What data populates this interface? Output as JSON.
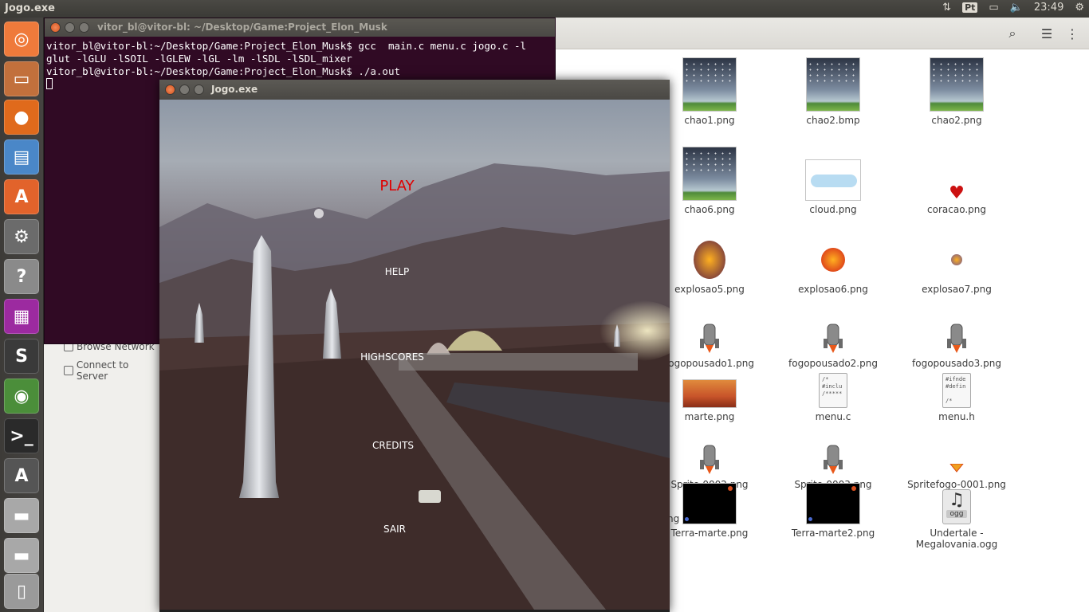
{
  "top_panel": {
    "app_title": "Jogo.exe",
    "keyboard_layout": "Pt",
    "clock": "23:49",
    "indicator_icons": [
      "network-arrows-icon",
      "battery-icon",
      "volume-icon",
      "gear-icon"
    ]
  },
  "launcher": {
    "items": [
      {
        "name": "dash-home-icon",
        "glyph": "◎",
        "color": "#ef7a3b"
      },
      {
        "name": "files-icon",
        "glyph": "▭",
        "color": "#c2703c"
      },
      {
        "name": "firefox-icon",
        "glyph": "●",
        "color": "#e06a1c"
      },
      {
        "name": "writer-icon",
        "glyph": "▤",
        "color": "#4a87c8"
      },
      {
        "name": "software-center-icon",
        "glyph": "A",
        "color": "#e2632b"
      },
      {
        "name": "system-settings-icon",
        "glyph": "⚙",
        "color": "#6b6b6b"
      },
      {
        "name": "help-icon",
        "glyph": "?",
        "color": "#8a8a8a"
      },
      {
        "name": "app-window-icon",
        "glyph": "▦",
        "color": "#9c2aa0"
      },
      {
        "name": "sublime-text-icon",
        "glyph": "S",
        "color": "#3a3a3a"
      },
      {
        "name": "chrome-icon",
        "glyph": "◉",
        "color": "#4b8e3a"
      },
      {
        "name": "terminal-icon",
        "glyph": ">_",
        "color": "#2a2a2a"
      },
      {
        "name": "software-updater-icon",
        "glyph": "A",
        "color": "#555555"
      },
      {
        "name": "drive-icon",
        "glyph": "▬",
        "color": "#a8a8a8"
      },
      {
        "name": "drive-2-icon",
        "glyph": "▬",
        "color": "#a8a8a8"
      },
      {
        "name": "trash-icon",
        "glyph": "▯",
        "color": "#9a9a9a"
      }
    ]
  },
  "file_manager": {
    "sidebar": {
      "items": [
        {
          "label": "Browse Network"
        },
        {
          "label": "Connect to Server"
        }
      ]
    },
    "files": [
      {
        "label": "chao1.png",
        "kind": "sky"
      },
      {
        "label": "chao2.bmp",
        "kind": "sky"
      },
      {
        "label": "chao2.png",
        "kind": "sky"
      },
      {
        "label": "chao6.png",
        "kind": "sky"
      },
      {
        "label": "cloud.png",
        "kind": "cloud"
      },
      {
        "label": "coracao.png",
        "kind": "heart"
      },
      {
        "label": "explosao5.png",
        "kind": "explosion"
      },
      {
        "label": "explosao6.png",
        "kind": "explosion"
      },
      {
        "label": "explosao7.png",
        "kind": "explosion"
      },
      {
        "label": "fogopousado1.png",
        "kind": "rocket"
      },
      {
        "label": "fogopousado2.png",
        "kind": "rocket"
      },
      {
        "label": "fogopousado3.png",
        "kind": "rocket"
      },
      {
        "label": "marte.png",
        "kind": "mars"
      },
      {
        "label": "menu.c",
        "kind": "doc",
        "preview": "/*\n#inclu\n/*****"
      },
      {
        "label": "menu.h",
        "kind": "doc",
        "preview": "#ifnde\n#defin\n\n/*"
      },
      {
        "label": "Sprite-0002.png",
        "kind": "rocket"
      },
      {
        "label": "Sprite-0003.png",
        "kind": "rocket"
      },
      {
        "label": "Spritefogo-0001.png",
        "kind": "flame"
      },
      {
        "label": "Terra-marte.png",
        "kind": "black"
      },
      {
        "label": "Terra-marte2.png",
        "kind": "black"
      },
      {
        "label": "Undertale -\nMegalovania.ogg",
        "kind": "ogg"
      }
    ],
    "partial_label": "ng"
  },
  "terminal": {
    "title": "vitor_bl@vitor-bl: ~/Desktop/Game:Project_Elon_Musk",
    "lines": [
      "vitor_bl@vitor-bl:~/Desktop/Game:Project_Elon_Musk$ gcc  main.c menu.c jogo.c -l",
      "glut -lGLU -lSOIL -lGLEW -lGL -lm -lSDL -lSDL_mixer",
      "vitor_bl@vitor-bl:~/Desktop/Game:Project_Elon_Musk$ ./a.out"
    ]
  },
  "game_window": {
    "title": "Jogo.exe",
    "menu": {
      "play": "PLAY",
      "help": "HELP",
      "highscores": "HIGHSCORES",
      "credits": "CREDITS",
      "exit": "SAIR"
    }
  },
  "colors": {
    "terminal_bg": "#300a24",
    "menu_play": "#e00000",
    "menu_text": "#ffffff"
  }
}
